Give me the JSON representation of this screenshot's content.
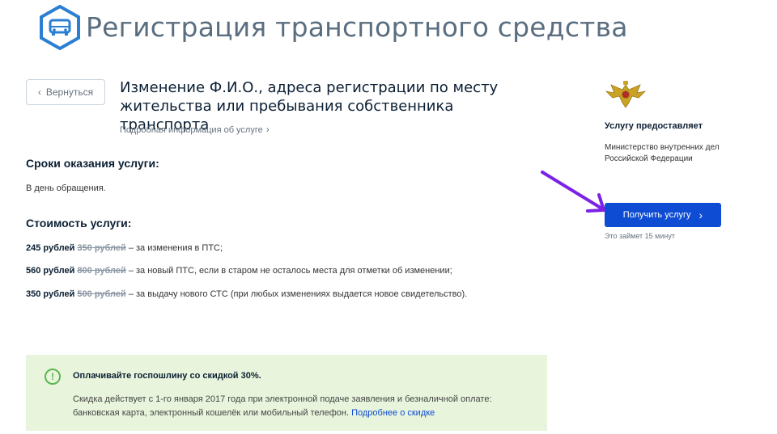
{
  "header": {
    "title": "Регистрация транспортного средства",
    "icon": "car-icon"
  },
  "back_button": {
    "label": "Вернуться"
  },
  "service": {
    "title": "Изменение Ф.И.О., адреса регистрации по месту жительства или пребывания собственника транспорта",
    "more_info": "Подробная информация об услуге"
  },
  "terms": {
    "heading": "Сроки оказания услуги:",
    "value": "В день обращения."
  },
  "cost": {
    "heading": "Стоимость услуги:",
    "rows": [
      {
        "price": "245 рублей",
        "old_price": "350 рублей",
        "desc": "– за изменения в ПТС;"
      },
      {
        "price": "560 рублей",
        "old_price": "800 рублей",
        "desc": "– за новый ПТС, если в старом не осталось места для отметки об изменении;"
      },
      {
        "price": "350 рублей",
        "old_price": "500 рублей",
        "desc": "– за выдачу нового СТС (при любых изменениях выдается новое свидетельство)."
      }
    ]
  },
  "notice": {
    "title": "Оплачивайте госпошлину со скидкой 30%.",
    "text": "Скидка действует с 1-го января 2017 года при электронной подаче заявления и безналичной оплате: банковская карта, электронный кошелёк или мобильный телефон.",
    "link": "Подробнее о скидке",
    "icon": "info-icon"
  },
  "provider": {
    "heading": "Услугу предоставляет",
    "name": "Министерство внутренних дел Российской Федерации",
    "emblem": "emblem-icon"
  },
  "action": {
    "label": "Получить услугу",
    "duration": "Это займет 15 минут"
  },
  "colors": {
    "primary": "#0d4cd3",
    "notice_bg": "#e8f5dc",
    "arrow": "#7b22e6",
    "icon_blue": "#2b7fd3"
  }
}
